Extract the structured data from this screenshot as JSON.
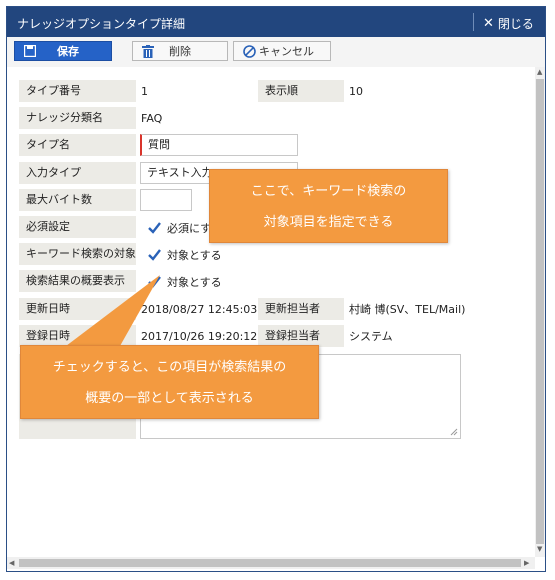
{
  "window": {
    "title": "ナレッジオプションタイプ詳細",
    "close_label": "閉じる"
  },
  "toolbar": {
    "save_label": "保存",
    "delete_label": "削除",
    "cancel_label": "キャンセル"
  },
  "form": {
    "type_number": {
      "label": "タイプ番号",
      "value": "1"
    },
    "display_order": {
      "label": "表示順",
      "value": "10"
    },
    "category": {
      "label": "ナレッジ分類名",
      "value": "FAQ"
    },
    "type_name": {
      "label": "タイプ名",
      "value": "質問"
    },
    "input_type": {
      "label": "入力タイプ",
      "value": "テキスト入力"
    },
    "max_bytes": {
      "label": "最大バイト数",
      "value": ""
    },
    "required": {
      "label": "必須設定",
      "checkbox_label": "必須にす",
      "checked": true
    },
    "keyword_target": {
      "label": "キーワード検索の対象",
      "checkbox_label": "対象とする",
      "checked": true
    },
    "summary_display": {
      "label": "検索結果の概要表示",
      "checkbox_label": "対象とする",
      "checked": true
    },
    "updated_at": {
      "label": "更新日時",
      "value": "2018/08/27 12:45:03"
    },
    "updated_by": {
      "label": "更新担当者",
      "value": "村崎 博(SV、TEL/Mail)"
    },
    "registered_at": {
      "label": "登録日時",
      "value": "2017/10/26 19:20:12"
    },
    "registered_by": {
      "label": "登録担当者",
      "value": "システム"
    }
  },
  "callouts": {
    "keyword": {
      "line1": "ここで、キーワード検索の",
      "line2": "対象項目を指定できる"
    },
    "summary": {
      "line1": "チェックすると、この項目が検索結果の",
      "line2": "概要の一部として表示される"
    }
  },
  "colors": {
    "titlebar": "#22467e",
    "save_button": "#2562c7",
    "label_bg": "#ecebe6",
    "callout": "#f39a40",
    "required_marker": "#d9342b"
  }
}
